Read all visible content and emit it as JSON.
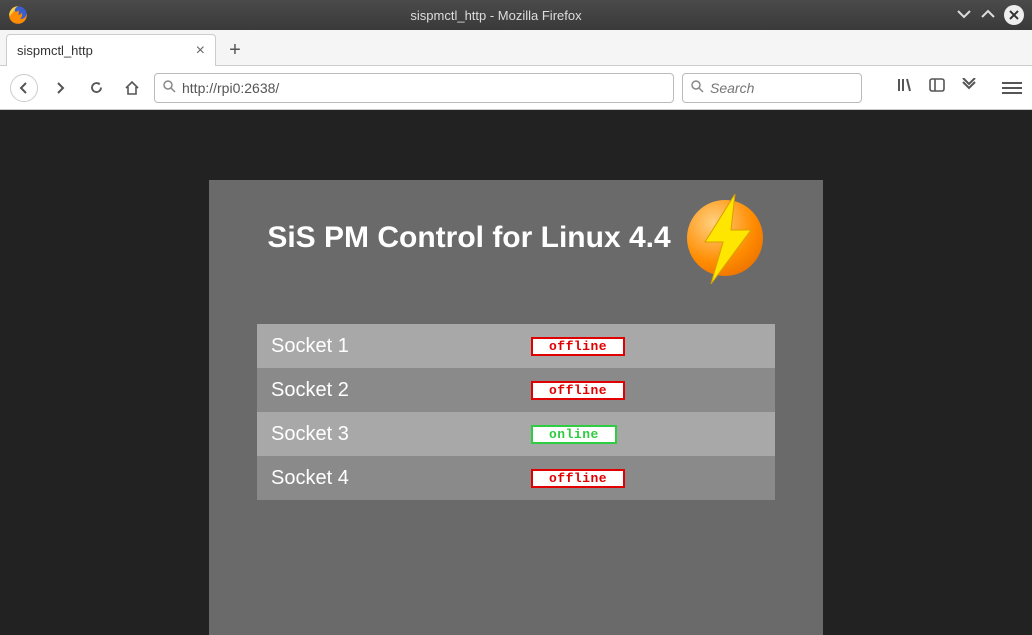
{
  "window": {
    "title": "sispmctl_http - Mozilla Firefox"
  },
  "tab": {
    "title": "sispmctl_http"
  },
  "navbar": {
    "url": "http://rpi0:2638/",
    "search_placeholder": "Search"
  },
  "page": {
    "heading": "SiS PM Control for Linux 4.4",
    "sockets": [
      {
        "label": "Socket 1",
        "status": "offline"
      },
      {
        "label": "Socket 2",
        "status": "offline"
      },
      {
        "label": "Socket 3",
        "status": "online"
      },
      {
        "label": "Socket 4",
        "status": "offline"
      }
    ]
  }
}
